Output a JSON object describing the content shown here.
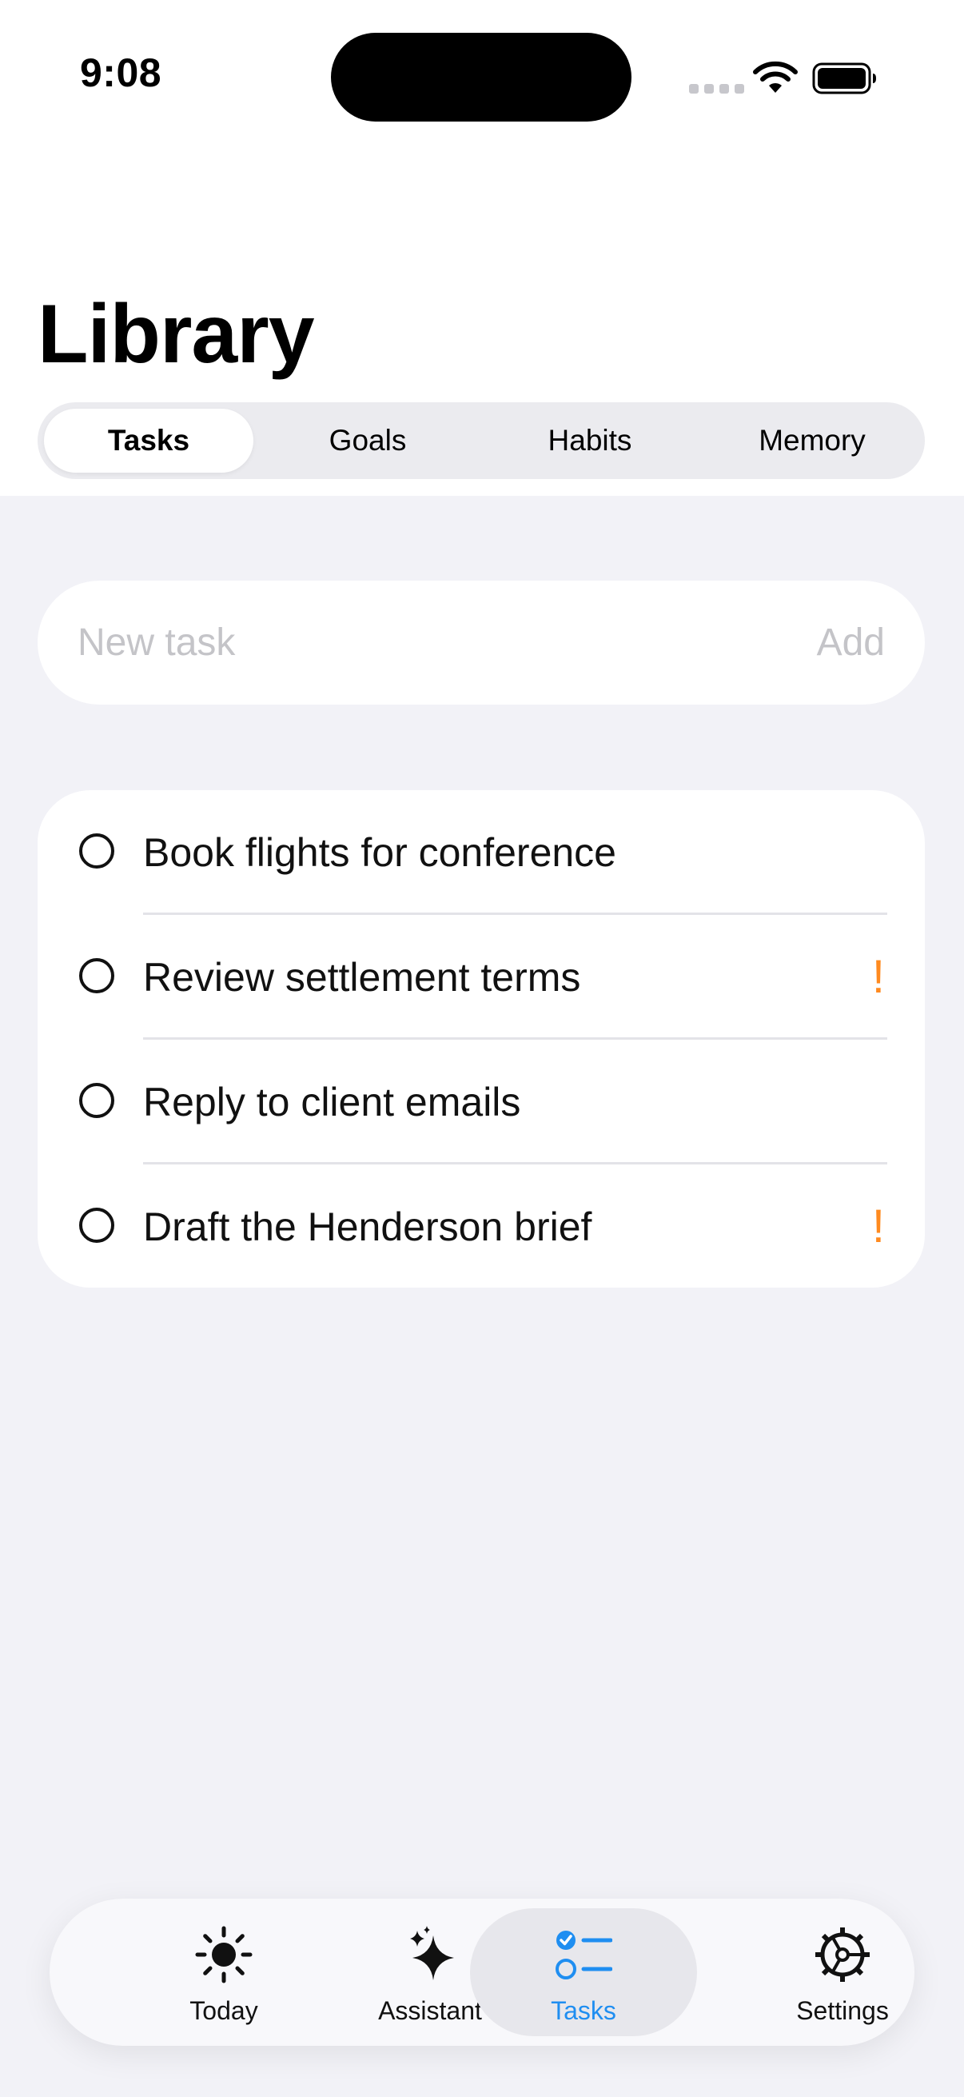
{
  "status_bar": {
    "time": "9:08"
  },
  "page": {
    "title": "Library"
  },
  "segments": [
    {
      "label": "Tasks",
      "selected": true
    },
    {
      "label": "Goals",
      "selected": false
    },
    {
      "label": "Habits",
      "selected": false
    },
    {
      "label": "Memory",
      "selected": false
    }
  ],
  "new_task": {
    "placeholder": "New task",
    "value": "",
    "add_label": "Add"
  },
  "tasks": [
    {
      "title": "Book flights for conference",
      "completed": false,
      "priority_mark": ""
    },
    {
      "title": "Review settlement terms",
      "completed": false,
      "priority_mark": "!"
    },
    {
      "title": "Reply to client emails",
      "completed": false,
      "priority_mark": ""
    },
    {
      "title": "Draft the Henderson brief",
      "completed": false,
      "priority_mark": "!"
    }
  ],
  "tab_bar": [
    {
      "label": "Today",
      "icon": "sun-icon",
      "selected": false
    },
    {
      "label": "Assistant",
      "icon": "sparkles-icon",
      "selected": false
    },
    {
      "label": "Tasks",
      "icon": "checklist-icon",
      "selected": true
    },
    {
      "label": "Settings",
      "icon": "gear-icon",
      "selected": false
    }
  ],
  "colors": {
    "accent": "#1f8ef1",
    "priority": "#ff8a1f",
    "background": "#f2f2f7"
  }
}
